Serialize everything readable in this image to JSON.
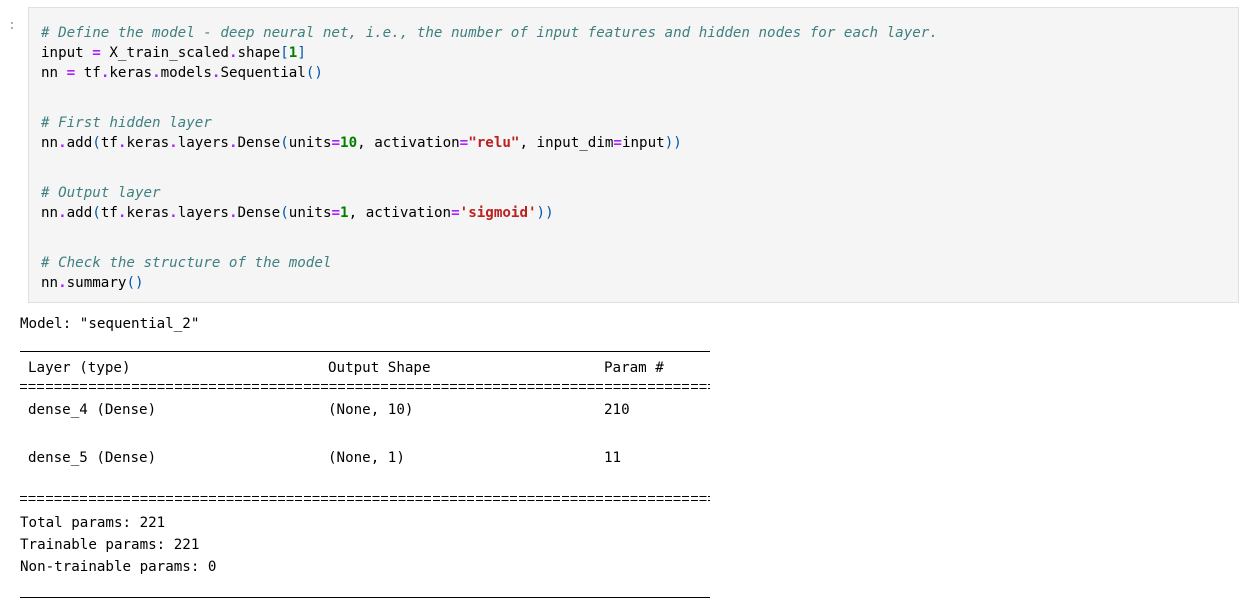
{
  "cell": {
    "prompt": ":",
    "code": {
      "line1_comment": "# Define the model - deep neural net, i.e., the number of input features and hidden nodes for each layer.",
      "line2": {
        "name": "input",
        "op": "=",
        "obj": "X_train_scaled",
        "dot": ".",
        "attr": "shape",
        "lb": "[",
        "idx": "1",
        "rb": "]"
      },
      "line3": {
        "name": "nn",
        "op": "=",
        "a": "tf",
        "b": "keras",
        "c": "models",
        "d": "Sequential",
        "parens": "()"
      },
      "line4_comment": "# First hidden layer",
      "line5": {
        "pre": "nn",
        "add": "add",
        "tf": "tf",
        "keras": "keras",
        "layers": "layers",
        "dense": "Dense",
        "units_kw": "units",
        "units_val": "10",
        "act_kw": "activation",
        "act_val": "\"relu\"",
        "inp_kw": "input_dim",
        "inp_val": "input"
      },
      "line6_comment": "# Output layer",
      "line7": {
        "pre": "nn",
        "add": "add",
        "tf": "tf",
        "keras": "keras",
        "layers": "layers",
        "dense": "Dense",
        "units_kw": "units",
        "units_val": "1",
        "act_kw": "activation",
        "act_val": "'sigmoid'"
      },
      "line8_comment": "# Check the structure of the model",
      "line9": {
        "pre": "nn",
        "fn": "summary",
        "parens": "()"
      }
    }
  },
  "output": {
    "model_label": "Model: \"sequential_2\"",
    "headers": [
      "Layer (type)",
      "Output Shape",
      "Param #"
    ],
    "rows": [
      {
        "layer": "dense_4 (Dense)",
        "shape": "(None, 10)",
        "params": "210"
      },
      {
        "layer": "dense_5 (Dense)",
        "shape": "(None, 1)",
        "params": "11"
      }
    ],
    "total": "Total params: 221",
    "trainable": "Trainable params: 221",
    "non_trainable": "Non-trainable params: 0"
  }
}
